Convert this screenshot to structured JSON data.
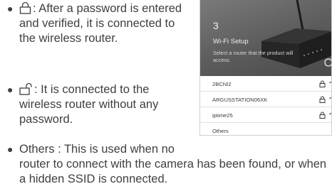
{
  "bullets": [
    {
      "icon": "lock-closed-icon",
      "text": ": After a password is entered and verified, it is connected to the wireless router."
    },
    {
      "icon": "lock-open-icon",
      "text": ": It is connected to the wireless router without any password."
    },
    {
      "first_line": "Others : This is used when no",
      "continuation": "router to connect with the camera has been found, or when a hidden SSID is connected."
    }
  ],
  "phone": {
    "step_number": "3",
    "title": "Wi-Fi Setup",
    "subtitle": "Select a router that the product will access.",
    "networks": [
      {
        "ssid": "2BCNI2",
        "secured": true
      },
      {
        "ssid": "ARGUSSTATION06XK",
        "secured": true
      },
      {
        "ssid": "iptime25",
        "secured": true
      },
      {
        "ssid": "Others",
        "secured": false
      }
    ]
  },
  "colors": {
    "text": "#3f3f3f",
    "header_bg": "#5b5b5b",
    "divider": "#e1e1e1"
  }
}
